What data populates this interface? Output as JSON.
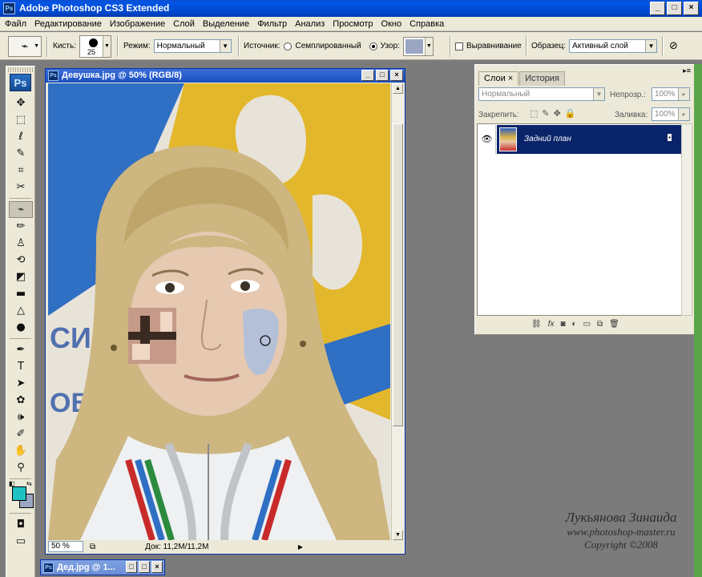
{
  "app": {
    "title": "Adobe Photoshop CS3 Extended",
    "icon_label": "Ps",
    "window_buttons": [
      "_",
      "□",
      "×"
    ]
  },
  "menu": [
    "Файл",
    "Редактирование",
    "Изображение",
    "Слой",
    "Выделение",
    "Фильтр",
    "Анализ",
    "Просмотр",
    "Окно",
    "Справка"
  ],
  "options": {
    "brush_label": "Кисть:",
    "brush_size": "25",
    "mode_label": "Режим:",
    "mode_value": "Нормальный",
    "source_label": "Источник:",
    "sampled_label": "Семплированный",
    "pattern_label": "Узор:",
    "pattern_color": "#9aa6c2",
    "aligned_label": "Выравнивание",
    "sample_label": "Образец:",
    "sample_value": "Активный слой"
  },
  "toolbox": {
    "logo": "Ps",
    "tools": [
      {
        "name": "move-tool-icon",
        "glyph": "✥"
      },
      {
        "name": "marquee-tool-icon",
        "glyph": "⬚"
      },
      {
        "name": "lasso-tool-icon",
        "glyph": "ℓ"
      },
      {
        "name": "quick-select-tool-icon",
        "glyph": "✎"
      },
      {
        "name": "crop-tool-icon",
        "glyph": "⌗"
      },
      {
        "name": "slice-tool-icon",
        "glyph": "✂"
      },
      {
        "name": "healing-brush-tool-icon",
        "glyph": "⌁",
        "active": true
      },
      {
        "name": "brush-tool-icon",
        "glyph": "✏"
      },
      {
        "name": "clone-stamp-tool-icon",
        "glyph": "♙"
      },
      {
        "name": "history-brush-tool-icon",
        "glyph": "⟲"
      },
      {
        "name": "eraser-tool-icon",
        "glyph": "◩"
      },
      {
        "name": "gradient-tool-icon",
        "glyph": "▬"
      },
      {
        "name": "blur-tool-icon",
        "glyph": "△"
      },
      {
        "name": "dodge-tool-icon",
        "glyph": "●"
      },
      {
        "name": "pen-tool-icon",
        "glyph": "✒"
      },
      {
        "name": "type-tool-icon",
        "glyph": "T"
      },
      {
        "name": "path-select-tool-icon",
        "glyph": "➤"
      },
      {
        "name": "shape-tool-icon",
        "glyph": "✿"
      },
      {
        "name": "notes-tool-icon",
        "glyph": "🕪"
      },
      {
        "name": "eyedropper-tool-icon",
        "glyph": "✐"
      },
      {
        "name": "hand-tool-icon",
        "glyph": "✋"
      },
      {
        "name": "zoom-tool-icon",
        "glyph": "⚲"
      }
    ],
    "fg_color": "#1fc2c2",
    "bg_color": "#9aa6c2"
  },
  "document": {
    "title": "Девушка.jpg @ 50% (RGB/8)",
    "zoom": "50 %",
    "doc_size": "Док: 11,2M/11,2M"
  },
  "minimized_doc": {
    "title": "Дед.jpg @ 1..."
  },
  "layers_panel": {
    "tabs": [
      "Слои",
      "История"
    ],
    "blend_mode": "Нормальный",
    "opacity_label": "Непрозр.:",
    "opacity_value": "100%",
    "lock_label": "Закрепить:",
    "fill_label": "Заливка:",
    "fill_value": "100%",
    "layer_name": "Задний план",
    "bottom_icons": [
      "link-icon",
      "fx-icon",
      "mask-icon",
      "adjustment-icon",
      "folder-icon",
      "new-layer-icon",
      "trash-icon"
    ]
  },
  "watermark": {
    "name": "Лукьянова Зинаида",
    "site": "www.photoshop-master.ru",
    "copyright": "Copyright ©2008"
  }
}
